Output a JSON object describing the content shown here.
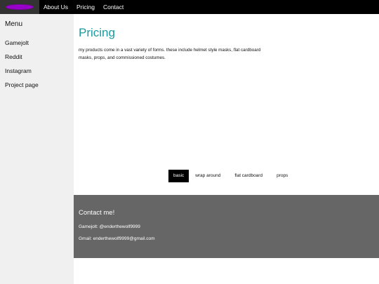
{
  "nav": {
    "links": [
      "About Us",
      "Pricing",
      "Contact"
    ]
  },
  "sidebar": {
    "title": "Menu",
    "items": [
      "Gamejolt",
      "Reddit",
      "Instagram",
      "Project page"
    ]
  },
  "main": {
    "title": "Pricing",
    "intro": "my products come in a vast variety of forms. these include helmet style masks, flat cardboard masks, props, and commissioned costumes.",
    "tabs": [
      "basic",
      "wrap around",
      "flat cardboard",
      "props"
    ],
    "active_tab": "basic"
  },
  "footer": {
    "title": "Contact me!",
    "gamejolt": "Gamejolt: @enderthewolf9999",
    "gmail": "Gmail: enderthewolf9999@gmail.com"
  },
  "colors": {
    "accent": "#1a9aa0",
    "logo": "#9900cc",
    "footer_bg": "#666666"
  }
}
